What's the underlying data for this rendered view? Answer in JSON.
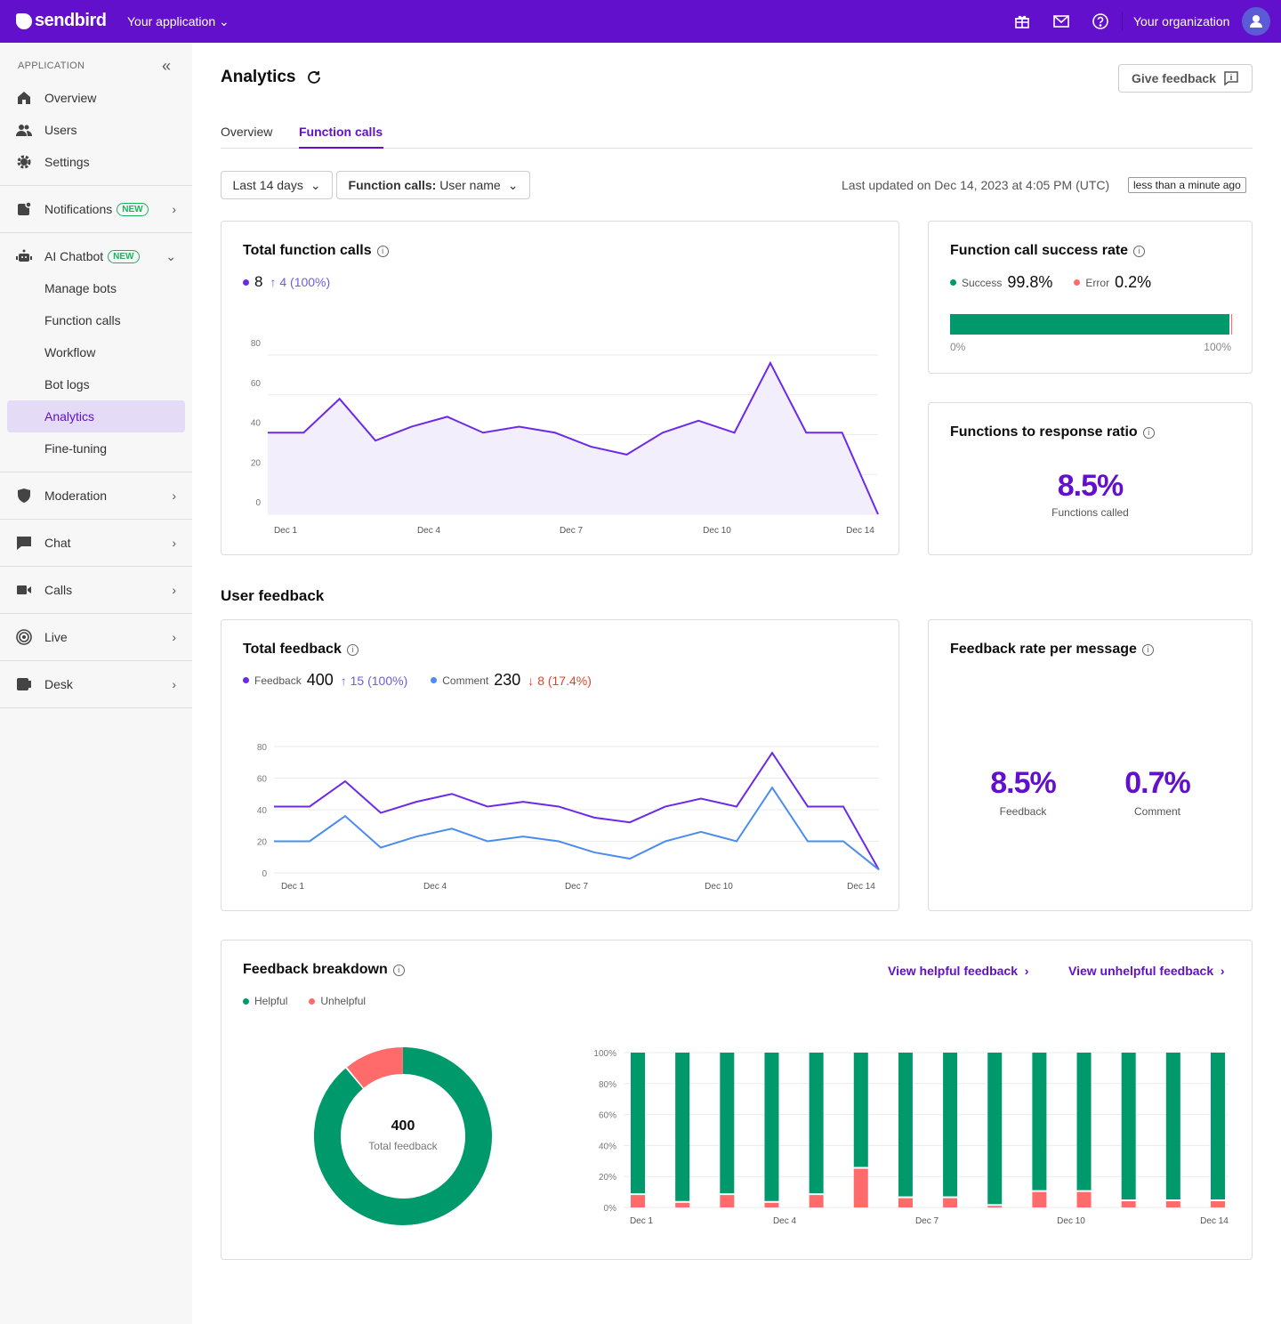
{
  "topbar": {
    "brand": "sendbird",
    "app": "Your application",
    "org": "Your organization",
    "icons": [
      "gift-icon",
      "mail-icon",
      "help-icon",
      "user-icon"
    ]
  },
  "sidebar": {
    "heading": "APPLICATION",
    "items": [
      {
        "label": "Overview",
        "icon": "home-icon"
      },
      {
        "label": "Users",
        "icon": "users-icon"
      },
      {
        "label": "Settings",
        "icon": "gear-icon"
      },
      {
        "label": "Notifications",
        "badge": "NEW",
        "icon": "notification-icon"
      },
      {
        "label": "AI Chatbot",
        "badge": "NEW",
        "icon": "bot-icon"
      },
      {
        "label": "Manage bots"
      },
      {
        "label": "Function calls"
      },
      {
        "label": "Workflow"
      },
      {
        "label": "Bot logs"
      },
      {
        "label": "Analytics",
        "active": true
      },
      {
        "label": "Fine-tuning"
      },
      {
        "label": "Moderation",
        "icon": "shield-icon"
      },
      {
        "label": "Chat",
        "icon": "chat-icon"
      },
      {
        "label": "Calls",
        "icon": "video-icon"
      },
      {
        "label": "Live",
        "icon": "live-icon"
      },
      {
        "label": "Desk",
        "icon": "desk-icon"
      }
    ]
  },
  "page": {
    "title": "Analytics",
    "feedback_button": "Give feedback",
    "tabs": [
      "Overview",
      "Function calls"
    ],
    "active_tab": "Function calls",
    "filter_period": "Last 14 days",
    "filter_group_label": "Function calls:",
    "filter_group_value": "User name",
    "last_updated": "Last updated on Dec 14, 2023 at 4:05 PM (UTC)",
    "updated_badge": "less than a minute ago"
  },
  "colors": {
    "brand": "#6210cc",
    "purple": "#6c2ae8",
    "blue": "#4a8cf0",
    "green": "#00996b",
    "red": "#ff6b6b"
  },
  "total_calls": {
    "title": "Total function calls",
    "value": "8",
    "delta": "4 (100%)"
  },
  "success": {
    "title": "Function call success rate",
    "success_label": "Success",
    "success_value": "99.8%",
    "error_label": "Error",
    "error_value": "0.2%",
    "success_pct": 99.8,
    "axis_min": "0%",
    "axis_max": "100%"
  },
  "ratio": {
    "title": "Functions to response ratio",
    "value": "8.5%",
    "caption": "Functions called"
  },
  "section_feedback": "User feedback",
  "total_feedback": {
    "title": "Total feedback",
    "feedback_label": "Feedback",
    "feedback_value": "400",
    "feedback_delta": "15 (100%)",
    "comment_label": "Comment",
    "comment_value": "230",
    "comment_delta": "8 (17.4%)"
  },
  "rate": {
    "title": "Feedback rate per message",
    "feedback_value": "8.5%",
    "feedback_caption": "Feedback",
    "comment_value": "0.7%",
    "comment_caption": "Comment"
  },
  "breakdown": {
    "title": "Feedback breakdown",
    "link_helpful": "View helpful feedback",
    "link_unhelpful": "View unhelpful feedback",
    "legend_helpful": "Helpful",
    "legend_unhelpful": "Unhelpful",
    "donut_value": "400",
    "donut_caption": "Total feedback"
  },
  "chart_data": [
    {
      "type": "area",
      "yticks": [
        "0",
        "20",
        "40",
        "60",
        "80"
      ],
      "ylim": [
        0,
        80
      ],
      "xticks": [
        "Dec 1",
        "Dec 4",
        "Dec 7",
        "Dec 10",
        "Dec 14"
      ],
      "series": [
        {
          "values": [
            41,
            41,
            58,
            37,
            44,
            49,
            41,
            44,
            41,
            34,
            30,
            41,
            47,
            41,
            76,
            41,
            41,
            0
          ]
        }
      ],
      "grid": true
    },
    {
      "type": "line",
      "yticks": [
        "0",
        "20",
        "40",
        "60",
        "80"
      ],
      "ylim": [
        0,
        80
      ],
      "xticks": [
        "Dec 1",
        "Dec 4",
        "Dec 7",
        "Dec 10",
        "Dec 14"
      ],
      "series": [
        {
          "name": "Feedback",
          "values": [
            42,
            42,
            58,
            38,
            45,
            50,
            42,
            45,
            42,
            35,
            32,
            42,
            47,
            42,
            76,
            42,
            42,
            2
          ]
        },
        {
          "name": "Comment",
          "values": [
            20,
            20,
            36,
            16,
            23,
            28,
            20,
            23,
            20,
            13,
            9,
            20,
            26,
            20,
            54,
            20,
            20,
            2
          ]
        }
      ],
      "grid": true
    },
    {
      "type": "pie",
      "series": [
        {
          "name": "Helpful",
          "value": 89
        },
        {
          "name": "Unhelpful",
          "value": 11
        }
      ]
    },
    {
      "type": "bar",
      "stacked": true,
      "yticks": [
        "0%",
        "20%",
        "40%",
        "60%",
        "80%",
        "100%"
      ],
      "ylim": [
        0,
        100
      ],
      "categories": [
        "Dec 1",
        "Dec 2",
        "Dec 3",
        "Dec 4",
        "Dec 5",
        "Dec 6",
        "Dec 7",
        "Dec 8",
        "Dec 9",
        "Dec 10",
        "Dec 11",
        "Dec 12",
        "Dec 13",
        "Dec 14"
      ],
      "xticks": [
        "Dec 1",
        "Dec 4",
        "Dec 7",
        "Dec 10",
        "Dec 14"
      ],
      "series": [
        {
          "name": "Unhelpful",
          "values": [
            8,
            3,
            8,
            3,
            8,
            25,
            6,
            6,
            1,
            10,
            10,
            4,
            4,
            4
          ]
        },
        {
          "name": "Helpful",
          "values": [
            92,
            97,
            92,
            97,
            92,
            75,
            94,
            94,
            99,
            90,
            90,
            96,
            96,
            96
          ]
        }
      ]
    }
  ]
}
